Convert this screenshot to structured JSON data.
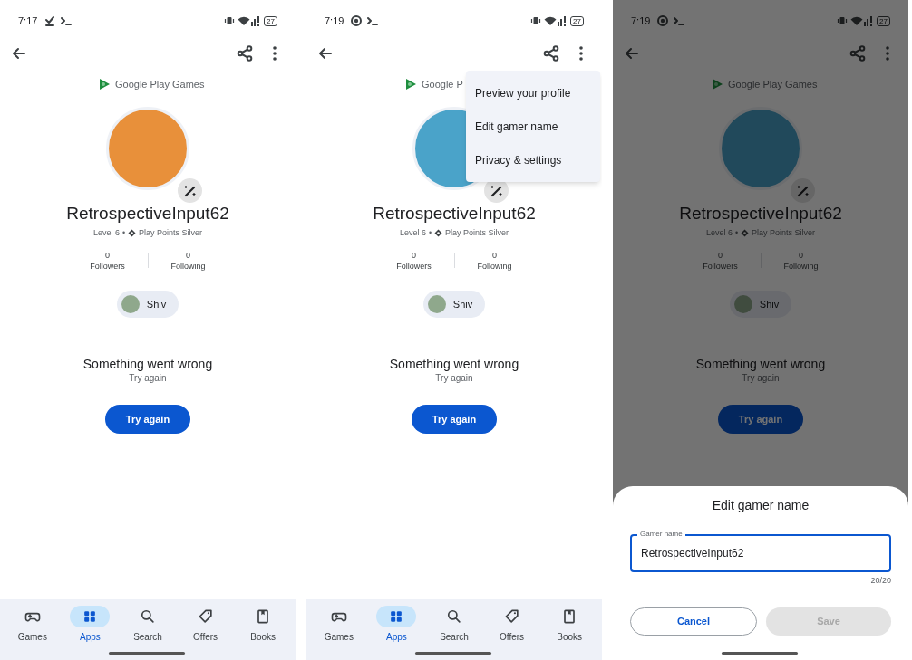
{
  "screens": [
    {
      "status_bar": {
        "time": "7:17",
        "notification_icons": [
          {
            "kind": "download"
          },
          {
            "kind": "terminal"
          }
        ],
        "battery": "27"
      },
      "brand": "Google Play Games",
      "avatar": {
        "kind": "portrait"
      },
      "profile": {
        "gamer_name": "RetrospectiveInput62",
        "level": "Level 6",
        "separator": "•",
        "play_points": "Play Points Silver",
        "stats": [
          {
            "value": "0",
            "label": "Followers"
          },
          {
            "value": "0",
            "label": "Following"
          }
        ],
        "account_chip": "Shiv"
      },
      "error": {
        "title": "Something went wrong",
        "subtitle": "Try again",
        "button": "Try again"
      },
      "dimmed": false,
      "nav": [
        {
          "kind": "games",
          "label": "Games",
          "selected": false
        },
        {
          "kind": "apps",
          "label": "Apps",
          "selected": true
        },
        {
          "kind": "search",
          "label": "Search",
          "selected": false
        },
        {
          "kind": "offers",
          "label": "Offers",
          "selected": false
        },
        {
          "kind": "books",
          "label": "Books",
          "selected": false
        }
      ]
    },
    {
      "status_bar": {
        "time": "7:19",
        "notification_icons": [
          {
            "kind": "record"
          },
          {
            "kind": "terminal"
          }
        ],
        "battery": "27"
      },
      "brand": "Google P",
      "avatar": {
        "kind": "illustration"
      },
      "profile": {
        "gamer_name": "RetrospectiveInput62",
        "level": "Level 6",
        "separator": "•",
        "play_points": "Play Points Silver",
        "stats": [
          {
            "value": "0",
            "label": "Followers"
          },
          {
            "value": "0",
            "label": "Following"
          }
        ],
        "account_chip": "Shiv"
      },
      "error": {
        "title": "Something went wrong",
        "subtitle": "Try again",
        "button": "Try again"
      },
      "dimmed": false,
      "nav": [
        {
          "kind": "games",
          "label": "Games",
          "selected": false
        },
        {
          "kind": "apps",
          "label": "Apps",
          "selected": true
        },
        {
          "kind": "search",
          "label": "Search",
          "selected": false
        },
        {
          "kind": "offers",
          "label": "Offers",
          "selected": false
        },
        {
          "kind": "books",
          "label": "Books",
          "selected": false
        }
      ],
      "menu": [
        "Preview your profile",
        "Edit gamer name",
        "Privacy & settings"
      ]
    },
    {
      "status_bar": {
        "time": "7:19",
        "notification_icons": [
          {
            "kind": "record"
          },
          {
            "kind": "terminal"
          }
        ],
        "battery": "27"
      },
      "brand": "Google Play Games",
      "avatar": {
        "kind": "illustration"
      },
      "profile": {
        "gamer_name": "RetrospectiveInput62",
        "level": "Level 6",
        "separator": "•",
        "play_points": "Play Points Silver",
        "stats": [
          {
            "value": "0",
            "label": "Followers"
          },
          {
            "value": "0",
            "label": "Following"
          }
        ],
        "account_chip": "Shiv"
      },
      "error": {
        "title": "Something went wrong",
        "subtitle": "Try again",
        "button": "Try again"
      },
      "dimmed": true,
      "sheet": {
        "title": "Edit gamer name",
        "field_label": "Gamer name",
        "value": "RetrospectiveInput62",
        "counter": "20/20",
        "buttons": [
          {
            "label": "Cancel",
            "disabled": false
          },
          {
            "label": "Save",
            "disabled": true
          }
        ]
      }
    }
  ]
}
